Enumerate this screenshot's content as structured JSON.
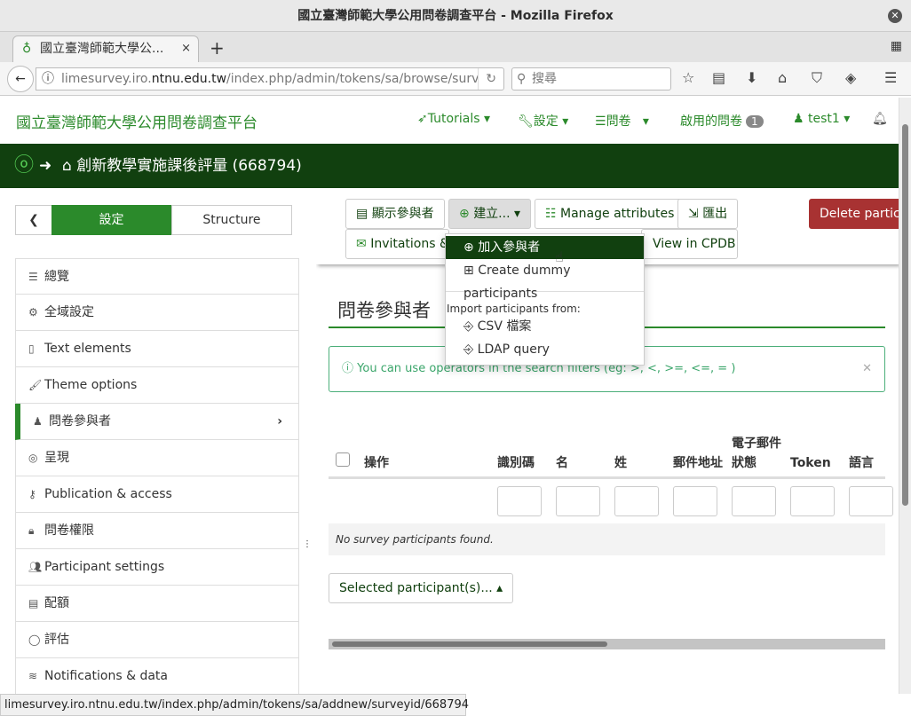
{
  "window": {
    "title": "國立臺灣師範大學公用問卷調查平台 - Mozilla Firefox",
    "close": "✕"
  },
  "browser": {
    "tab_title": "國立臺灣師範大學公...",
    "tab_close": "×",
    "new_tab": "+",
    "url_prefix": "limesurvey.iro.",
    "url_domain": "ntnu.edu.tw",
    "url_path": "/index.php/admin/tokens/sa/browse/survey",
    "search_placeholder": "搜尋",
    "status_url": "limesurvey.iro.ntnu.edu.tw/index.php/admin/tokens/sa/addnew/surveyid/668794"
  },
  "header": {
    "brand": "國立臺灣師範大學公用問卷調查平台",
    "tutorials": "Tutorials",
    "settings": "設定",
    "surveys": "問卷",
    "active_surveys": "啟用的問卷",
    "active_count": "1",
    "user": "test1"
  },
  "breadcrumb": {
    "survey": "創新教學實施課後評量 (668794)"
  },
  "sidebar": {
    "tab_settings": "設定",
    "tab_structure": "Structure",
    "items": [
      {
        "label": "總覽",
        "icon": "list-icon"
      },
      {
        "label": "全域設定",
        "icon": "cogs-icon"
      },
      {
        "label": "Text elements",
        "icon": "file-text-icon"
      },
      {
        "label": "Theme options",
        "icon": "paint-brush-icon"
      },
      {
        "label": "問卷參與者",
        "icon": "user-icon"
      },
      {
        "label": "呈現",
        "icon": "eye-slash-icon"
      },
      {
        "label": "Publication & access",
        "icon": "key-icon"
      },
      {
        "label": "問卷權限",
        "icon": "lock-icon"
      },
      {
        "label": "Participant settings",
        "icon": "users-icon"
      },
      {
        "label": "配額",
        "icon": "tasks-icon"
      },
      {
        "label": "評估",
        "icon": "comment-icon"
      },
      {
        "label": "Notifications & data",
        "icon": "rss-icon"
      }
    ]
  },
  "toolbar": {
    "display": "顯示參與者",
    "create": "建立...",
    "manage_attributes": "Manage attributes",
    "export": "匯出",
    "delete": "Delete participants",
    "invitations": "Invitations & reminders",
    "view_cpdb": "View in CPDB"
  },
  "dropdown": {
    "add": "加入參與者",
    "dummy": "Create dummy participants",
    "import_header": "Import participants from:",
    "csv": "CSV 檔案",
    "ldap": "LDAP query"
  },
  "main": {
    "title": "問卷參與者",
    "info": "You can use operators in the search filters (eg: >, <, >=, <=, = )",
    "columns": [
      "操作",
      "識別碼",
      "名",
      "姓",
      "郵件地址",
      "電子郵件狀態",
      "Token",
      "語言"
    ],
    "empty": "No survey participants found.",
    "selected": "Selected participant(s)..."
  },
  "colors": {
    "brand": "#2b8a2b",
    "dark": "#11400f",
    "danger": "#a83232"
  }
}
